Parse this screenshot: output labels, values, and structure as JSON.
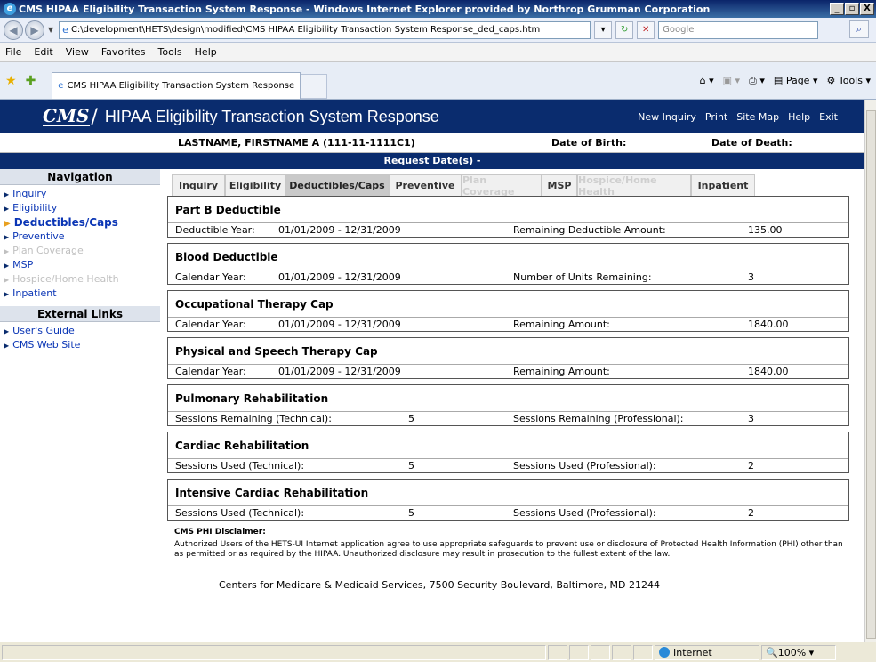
{
  "window": {
    "title": "CMS HIPAA Eligibility Transaction System Response - Windows Internet Explorer provided by Northrop Grumman Corporation",
    "min": "_",
    "max": "▫",
    "close": "X"
  },
  "address": {
    "url": "C:\\development\\HETS\\design\\modified\\CMS HIPAA Eligibility Transaction System Response_ded_caps.htm",
    "search_placeholder": "Google"
  },
  "menu": [
    "File",
    "Edit",
    "View",
    "Favorites",
    "Tools",
    "Help"
  ],
  "browser_tab": {
    "label": "CMS HIPAA Eligibility Transaction System Response"
  },
  "command_bar": {
    "page": "Page",
    "tools": "Tools"
  },
  "banner": {
    "logo": "CMS",
    "title": "HIPAA Eligibility Transaction System Response",
    "links": [
      "New Inquiry",
      "Print",
      "Site Map",
      "Help",
      "Exit"
    ]
  },
  "patient": {
    "name": "LASTNAME, FIRSTNAME  A  (111-11-1111C1)",
    "dob_label": "Date of Birth:",
    "dod_label": "Date of Death:"
  },
  "request_dates": "Request Date(s) -",
  "nav": {
    "heading": "Navigation",
    "items": [
      {
        "label": "Inquiry",
        "state": "normal"
      },
      {
        "label": "Eligibility",
        "state": "normal"
      },
      {
        "label": "Deductibles/Caps",
        "state": "active"
      },
      {
        "label": "Preventive",
        "state": "normal"
      },
      {
        "label": "Plan Coverage",
        "state": "disabled"
      },
      {
        "label": "MSP",
        "state": "normal"
      },
      {
        "label": "Hospice/Home Health",
        "state": "disabled"
      },
      {
        "label": "Inpatient",
        "state": "normal"
      }
    ],
    "external_heading": "External Links",
    "external": [
      "User's Guide",
      "CMS Web Site"
    ]
  },
  "tabs": [
    {
      "label": "Inquiry",
      "state": "normal"
    },
    {
      "label": "Eligibility",
      "state": "normal"
    },
    {
      "label": "Deductibles/Caps",
      "state": "selected"
    },
    {
      "label": "Preventive",
      "state": "normal"
    },
    {
      "label": "Plan Coverage",
      "state": "disabled"
    },
    {
      "label": "MSP",
      "state": "normal"
    },
    {
      "label": "Hospice/Home Health",
      "state": "disabled"
    },
    {
      "label": "Inpatient",
      "state": "normal"
    }
  ],
  "cards": [
    {
      "title": "Part B Deductible",
      "l1": "Deductible Year:",
      "v1": "01/01/2009 - 12/31/2009",
      "l2": "Remaining Deductible Amount:",
      "v2": "135.00"
    },
    {
      "title": "Blood Deductible",
      "l1": "Calendar Year:",
      "v1": "01/01/2009 - 12/31/2009",
      "l2": "Number of Units Remaining:",
      "v2": "3"
    },
    {
      "title": "Occupational Therapy Cap",
      "l1": "Calendar Year:",
      "v1": "01/01/2009 - 12/31/2009",
      "l2": "Remaining Amount:",
      "v2": "1840.00"
    },
    {
      "title": "Physical and Speech Therapy Cap",
      "l1": "Calendar Year:",
      "v1": "01/01/2009 - 12/31/2009",
      "l2": "Remaining Amount:",
      "v2": "1840.00"
    },
    {
      "title": "Pulmonary Rehabilitation",
      "l1": "Sessions Remaining (Technical):",
      "v1": "5",
      "l2": "Sessions Remaining (Professional):",
      "v2": "3"
    },
    {
      "title": "Cardiac Rehabilitation",
      "l1": "Sessions Used (Technical):",
      "v1": "5",
      "l2": "Sessions Used (Professional):",
      "v2": "2"
    },
    {
      "title": "Intensive Cardiac Rehabilitation",
      "l1": "Sessions Used (Technical):",
      "v1": "5",
      "l2": "Sessions Used (Professional):",
      "v2": "2"
    }
  ],
  "disclaimer": {
    "title": "CMS PHI Disclaimer:",
    "text": "Authorized Users of the HETS-UI Internet application agree to use appropriate safeguards to prevent use or disclosure of Protected Health Information (PHI) other than as permitted or as required by the HIPAA. Unauthorized disclosure may result in prosecution to the fullest extent of the law."
  },
  "footer": "Centers for Medicare & Medicaid Services, 7500 Security Boulevard, Baltimore, MD 21244",
  "status": {
    "zone": "Internet",
    "zoom": "100%"
  }
}
